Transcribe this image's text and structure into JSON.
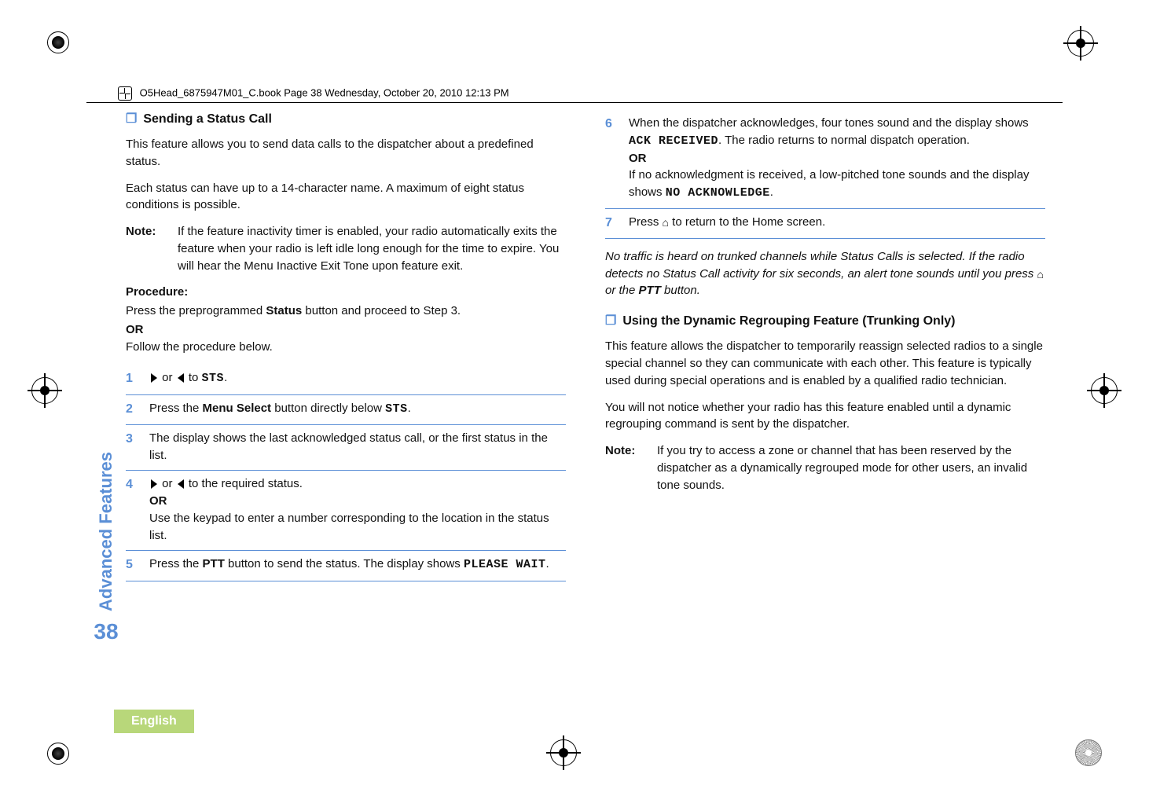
{
  "header": "O5Head_6875947M01_C.book  Page 38  Wednesday, October 20, 2010  12:13 PM",
  "sidebar_text": "Advanced Features",
  "page_number": "38",
  "language_tab": "English",
  "left": {
    "heading": "Sending a Status Call",
    "p1": "This feature allows you to send data calls to the dispatcher about a predefined status.",
    "p2": "Each status can have up to a 14-character name. A maximum of eight status conditions is possible.",
    "note_label": "Note:",
    "note_text": "If the feature inactivity timer is enabled, your radio automatically exits the feature when your radio is left idle long enough for the time to expire. You will hear the Menu Inactive Exit Tone upon feature exit.",
    "procedure_label": "Procedure:",
    "proc_intro1_a": "Press the preprogrammed ",
    "proc_intro1_b": "Status",
    "proc_intro1_c": " button and proceed to Step 3.",
    "proc_or": "OR",
    "proc_intro2": "Follow the procedure below.",
    "steps": {
      "s1": {
        "num": "1",
        "a": " or ",
        "b": " to ",
        "c": "STS",
        "d": "."
      },
      "s2": {
        "num": "2",
        "a": "Press the ",
        "b": "Menu Select",
        "c": " button directly below ",
        "d": "STS",
        "e": "."
      },
      "s3": {
        "num": "3",
        "text": "The display shows the last acknowledged status call, or the first status in the list."
      },
      "s4": {
        "num": "4",
        "a": " or ",
        "b": " to the required status.",
        "or": "OR",
        "c": "Use the keypad to enter a number corresponding to the location in the status list."
      },
      "s5": {
        "num": "5",
        "a": "Press the ",
        "b": "PTT",
        "c": " button to send the status. The display shows ",
        "d": "PLEASE WAIT",
        "e": "."
      }
    }
  },
  "right": {
    "s6": {
      "num": "6",
      "a": "When the dispatcher acknowledges, four tones sound and the display shows ",
      "b": "ACK RECEIVED",
      "c": ". The radio returns to normal dispatch operation.",
      "or": "OR",
      "d": "If no acknowledgment is received, a low-pitched tone sounds and the display shows ",
      "e": "NO ACKNOWLEDGE",
      "f": "."
    },
    "s7": {
      "num": "7",
      "a": "Press ",
      "b": " to return to the Home screen."
    },
    "ital_a": "No traffic is heard on trunked channels while Status Calls is selected. If the radio detects no Status Call activity for six seconds, an alert tone sounds until you press ",
    "ital_b": " or the ",
    "ital_c": "PTT",
    "ital_d": " button.",
    "heading2": "Using the Dynamic Regrouping Feature (Trunking Only)",
    "p1": "This feature allows the dispatcher to temporarily reassign selected radios to a single special channel so they can communicate with each other. This feature is typically used during special operations and is enabled by a qualified radio technician.",
    "p2": "You will not notice whether your radio has this feature enabled until a dynamic regrouping command is sent by the dispatcher.",
    "note_label": "Note:",
    "note_text": "If you try to access a zone or channel that has been reserved by the dispatcher as a dynamically regrouped mode for other users, an invalid tone sounds."
  }
}
